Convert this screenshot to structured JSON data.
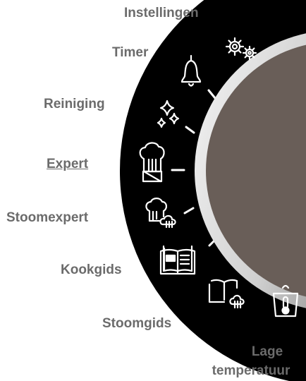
{
  "selected_mode": "Expert",
  "colors": {
    "ring": "#000000",
    "knob_fill": "#695e58",
    "bezel_light": "#f2f2f2",
    "bezel_dark": "#6a6a6a",
    "label_text": "#6b6b6b",
    "icon_stroke": "#ffffff"
  },
  "modes": [
    {
      "id": "instellingen",
      "label": "Instellingen",
      "icon": "gears-icon"
    },
    {
      "id": "timer",
      "label": "Timer",
      "icon": "bell-icon"
    },
    {
      "id": "reiniging",
      "label": "Reiniging",
      "icon": "sparkle-icon"
    },
    {
      "id": "expert",
      "label": "Expert",
      "icon": "chef-hat-icon"
    },
    {
      "id": "stoomexpert",
      "label": "Stoomexpert",
      "icon": "chef-hat-steam-icon"
    },
    {
      "id": "kookgids",
      "label": "Kookgids",
      "icon": "open-book-icon"
    },
    {
      "id": "stoomgids",
      "label": "Stoomgids",
      "icon": "open-book-steam-icon"
    },
    {
      "id": "lage_temperatuur",
      "label_line1": "Lage",
      "label_line2": "temperatuur",
      "icon": "pot-thermometer-icon"
    }
  ]
}
